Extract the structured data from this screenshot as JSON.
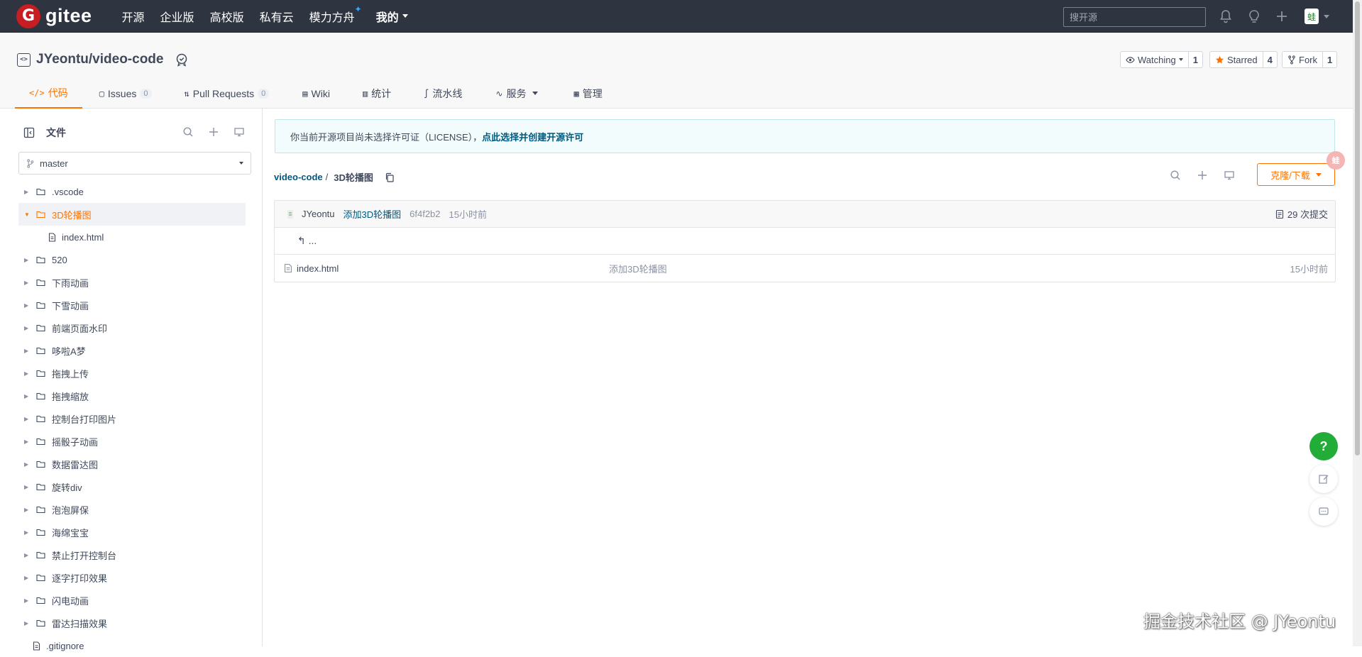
{
  "topnav": {
    "logo_glyph": "G",
    "logo_text": "gitee",
    "items": [
      "开源",
      "企业版",
      "高校版",
      "私有云",
      "模力方舟"
    ],
    "sparkle": "✦",
    "mine": "我的",
    "search_placeholder": "搜开源",
    "icons": [
      "bell-icon",
      "lightbulb-icon",
      "plus-icon",
      "avatar"
    ],
    "avatar_glyph": "蛙"
  },
  "repo": {
    "icon_glyph": "<>",
    "name": "JYeontu/video-code",
    "actions": {
      "watch_label": "Watching",
      "watch_count": "1",
      "star_label": "Starred",
      "star_count": "4",
      "fork_label": "Fork",
      "fork_count": "1"
    },
    "tabs": [
      {
        "glyph": "</>",
        "label": "代码"
      },
      {
        "glyph": "▢",
        "label": "Issues",
        "count": "0"
      },
      {
        "glyph": "⇅",
        "label": "Pull Requests",
        "count": "0"
      },
      {
        "glyph": "▤",
        "label": "Wiki"
      },
      {
        "glyph": "▥",
        "label": "统计"
      },
      {
        "glyph": "∫",
        "label": "流水线"
      },
      {
        "glyph": "∿",
        "label": "服务"
      },
      {
        "glyph": "▦",
        "label": "管理"
      }
    ]
  },
  "sidebar": {
    "title": "文件",
    "branch": "master",
    "tree": [
      {
        "label": ".vscode",
        "type": "folder"
      },
      {
        "label": "3D轮播图",
        "type": "folder",
        "open": true,
        "selected": true
      },
      {
        "label": "index.html",
        "type": "child-file"
      },
      {
        "label": "520",
        "type": "folder"
      },
      {
        "label": "下雨动画",
        "type": "folder"
      },
      {
        "label": "下雪动画",
        "type": "folder"
      },
      {
        "label": "前端页面水印",
        "type": "folder"
      },
      {
        "label": "哆啦A梦",
        "type": "folder"
      },
      {
        "label": "拖拽上传",
        "type": "folder"
      },
      {
        "label": "拖拽缩放",
        "type": "folder"
      },
      {
        "label": "控制台打印图片",
        "type": "folder"
      },
      {
        "label": "摇骰子动画",
        "type": "folder"
      },
      {
        "label": "数据雷达图",
        "type": "folder"
      },
      {
        "label": "旋转div",
        "type": "folder"
      },
      {
        "label": "泡泡屏保",
        "type": "folder"
      },
      {
        "label": "海绵宝宝",
        "type": "folder"
      },
      {
        "label": "禁止打开控制台",
        "type": "folder"
      },
      {
        "label": "逐字打印效果",
        "type": "folder"
      },
      {
        "label": "闪电动画",
        "type": "folder"
      },
      {
        "label": "雷达扫描效果",
        "type": "folder"
      },
      {
        "label": ".gitignore",
        "type": "file"
      }
    ]
  },
  "main": {
    "notice_text": "你当前开源项目尚未选择许可证（LICENSE），",
    "notice_link": "点此选择并创建开源许可",
    "crumb_root": "video-code",
    "crumb_sep": "/",
    "crumb_current": "3D轮播图",
    "clone_label": "克隆/下载",
    "float_avatar": "蛙",
    "commit": {
      "author": "JYeontu",
      "message": "添加3D轮播图",
      "sha": "6f4f2b2",
      "time": "15小时前",
      "count": "29 次提交"
    },
    "up_label": "↰ ...",
    "files": [
      {
        "name": "index.html",
        "message": "添加3D轮播图",
        "time": "15小时前"
      }
    ],
    "help_label": "?",
    "watermark": "掘金技术社区 @ JYeontu"
  },
  "colors": {
    "nav_bg": "#2e3440",
    "accent": "#fe7300",
    "link": "#005980",
    "help_green": "#22ac38",
    "logo_red": "#c71d23"
  }
}
